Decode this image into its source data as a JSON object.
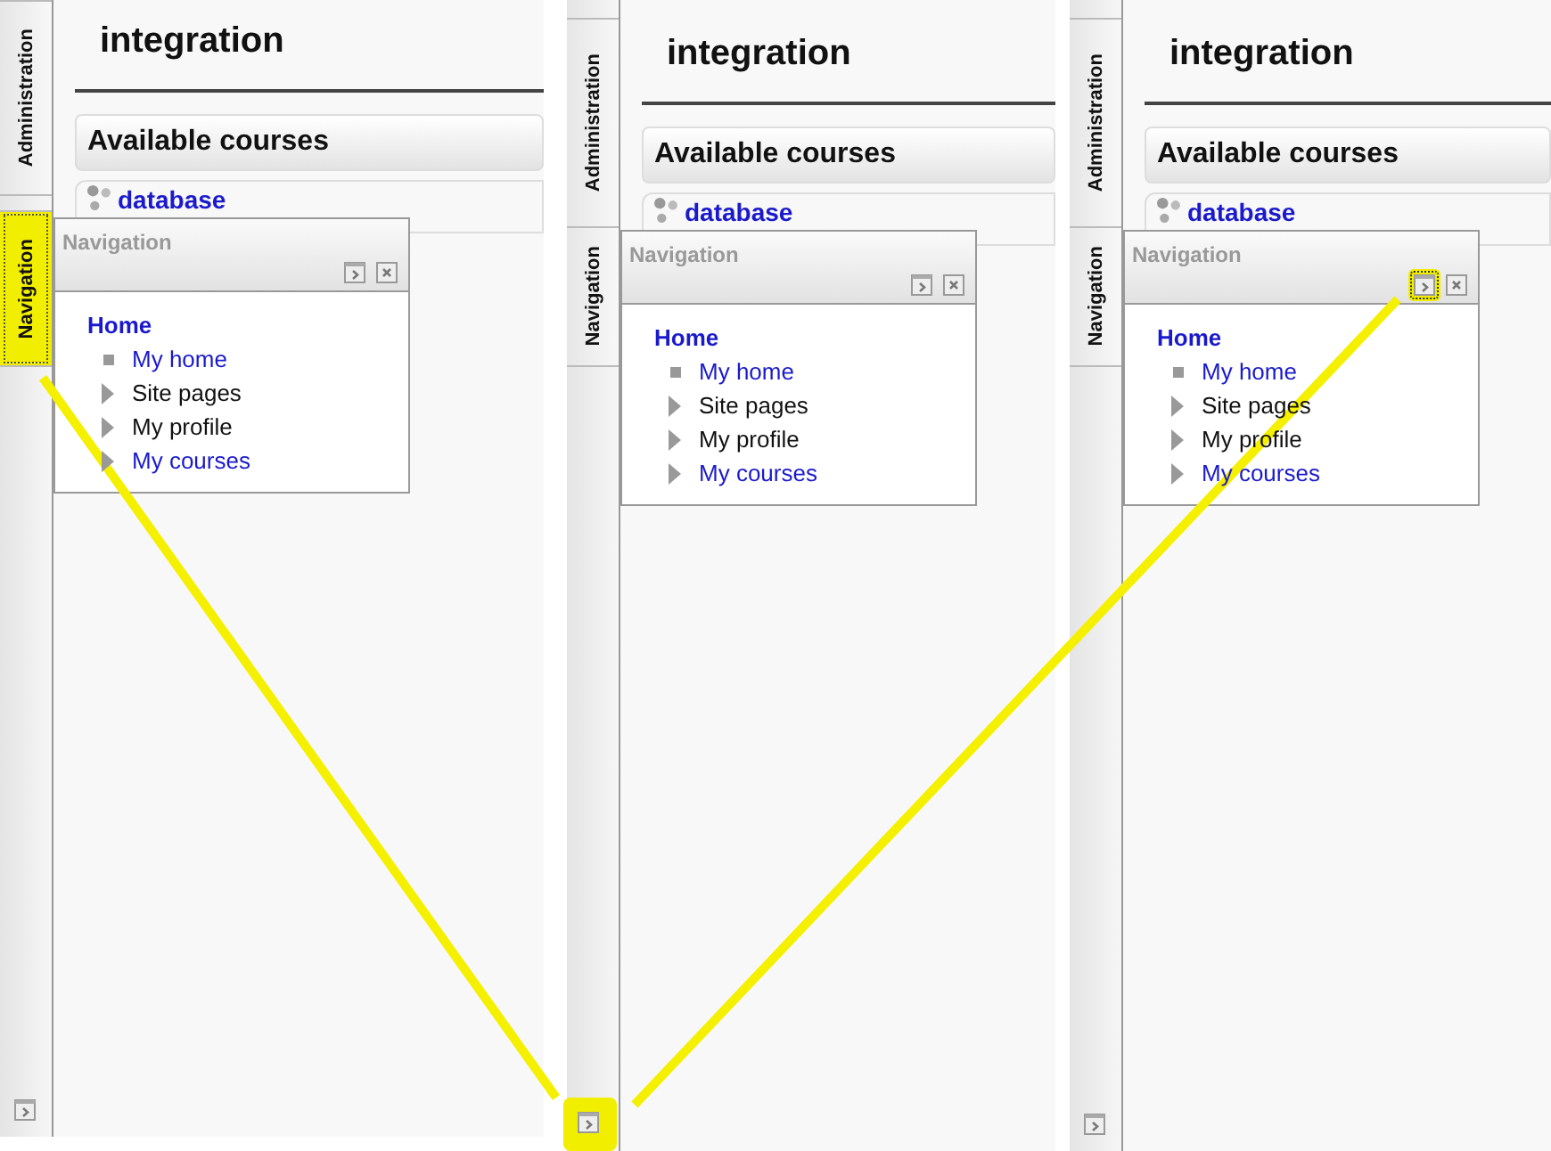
{
  "panels": [
    {
      "tabs": [
        {
          "label": "Administration",
          "highlighted": false
        },
        {
          "label": "Navigation",
          "highlighted": true
        }
      ],
      "dock_highlighted": false,
      "heading": "integration",
      "section": "Available courses",
      "course": "database",
      "block": {
        "title": "Navigation",
        "dock_highlighted": false,
        "home": "Home",
        "items": [
          {
            "label": "My home",
            "kind": "leaf",
            "link": true
          },
          {
            "label": "Site pages",
            "kind": "branch",
            "link": false
          },
          {
            "label": "My profile",
            "kind": "branch",
            "link": false
          },
          {
            "label": "My courses",
            "kind": "branch",
            "link": true
          }
        ]
      }
    },
    {
      "tabs": [
        {
          "label": "Administration",
          "highlighted": false
        },
        {
          "label": "Navigation",
          "highlighted": false
        }
      ],
      "dock_highlighted": true,
      "heading": "integration",
      "section": "Available courses",
      "course": "database",
      "block": {
        "title": "Navigation",
        "dock_highlighted": false,
        "home": "Home",
        "items": [
          {
            "label": "My home",
            "kind": "leaf",
            "link": true
          },
          {
            "label": "Site pages",
            "kind": "branch",
            "link": false
          },
          {
            "label": "My profile",
            "kind": "branch",
            "link": false
          },
          {
            "label": "My courses",
            "kind": "branch",
            "link": true
          }
        ]
      }
    },
    {
      "tabs": [
        {
          "label": "Administration",
          "highlighted": false
        },
        {
          "label": "Navigation",
          "highlighted": false
        }
      ],
      "dock_highlighted": false,
      "heading": "integration",
      "section": "Available courses",
      "course": "database",
      "block": {
        "title": "Navigation",
        "dock_highlighted": true,
        "home": "Home",
        "items": [
          {
            "label": "My home",
            "kind": "leaf",
            "link": true
          },
          {
            "label": "Site pages",
            "kind": "branch",
            "link": false
          },
          {
            "label": "My profile",
            "kind": "branch",
            "link": false
          },
          {
            "label": "My courses",
            "kind": "branch",
            "link": true
          }
        ]
      }
    }
  ]
}
